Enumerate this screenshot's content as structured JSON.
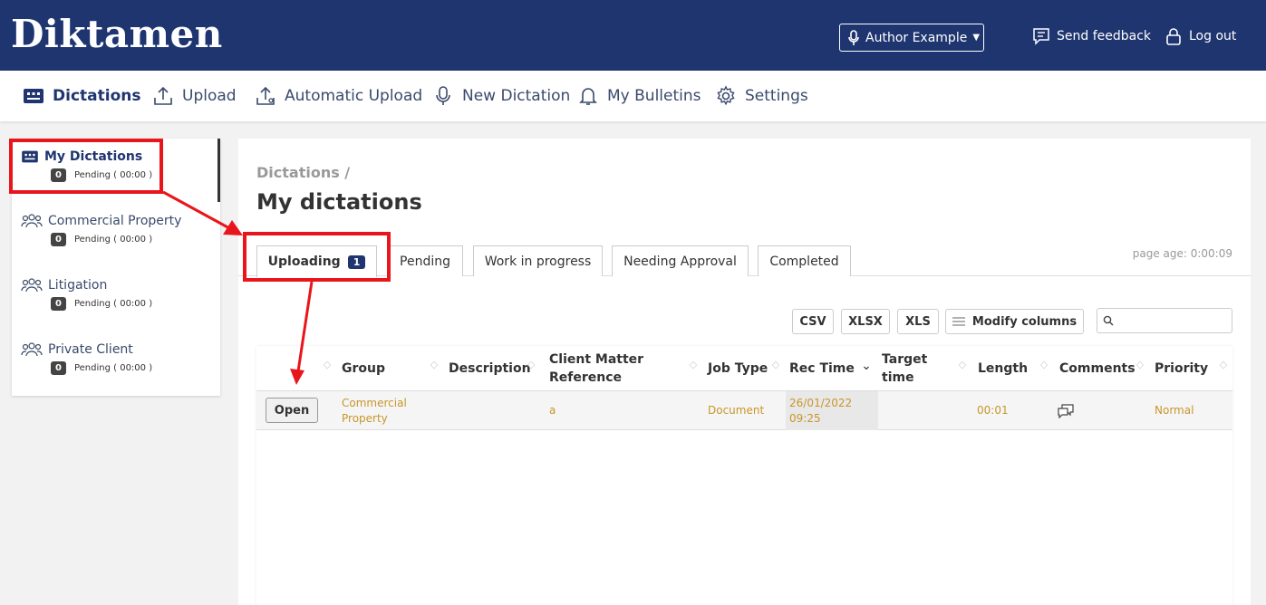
{
  "header": {
    "logo": "Diktamen",
    "author_label": "Author Example",
    "feedback_label": "Send feedback",
    "logout_label": "Log out"
  },
  "nav": {
    "items": [
      {
        "label": "Dictations",
        "icon": "dictations-icon"
      },
      {
        "label": "Upload",
        "icon": "upload-icon"
      },
      {
        "label": "Automatic Upload",
        "icon": "automatic-upload-icon"
      },
      {
        "label": "New Dictation",
        "icon": "microphone-icon"
      },
      {
        "label": "My Bulletins",
        "icon": "bell-icon"
      },
      {
        "label": "Settings",
        "icon": "gear-icon"
      }
    ]
  },
  "sidebar": {
    "items": [
      {
        "label": "My Dictations",
        "count": "0",
        "pending": "Pending ( 00:00 )"
      },
      {
        "label": "Commercial Property",
        "count": "0",
        "pending": "Pending ( 00:00 )"
      },
      {
        "label": "Litigation",
        "count": "0",
        "pending": "Pending ( 00:00 )"
      },
      {
        "label": "Private Client",
        "count": "0",
        "pending": "Pending ( 00:00 )"
      }
    ]
  },
  "main": {
    "breadcrumb": "Dictations /",
    "title": "My dictations",
    "page_age": "page age: 0:00:09",
    "tabs": [
      {
        "label": "Uploading",
        "count": "1"
      },
      {
        "label": "Pending"
      },
      {
        "label": "Work in progress"
      },
      {
        "label": "Needing Approval"
      },
      {
        "label": "Completed"
      }
    ],
    "toolbar": {
      "csv": "CSV",
      "xlsx": "XLSX",
      "xls": "XLS",
      "modify": "Modify columns",
      "search_placeholder": ""
    },
    "table": {
      "columns": [
        "Group",
        "Description",
        "Client Matter Reference",
        "Job Type",
        "Rec Time",
        "Target time",
        "Length",
        "Comments",
        "Priority"
      ],
      "rows": [
        {
          "action": "Open",
          "group": "Commercial Property",
          "description": "",
          "client_matter_reference": "a",
          "job_type": "Document",
          "rec_time": "26/01/2022 09:25",
          "target_time": "",
          "length": "00:01",
          "comments_icon": "comments-icon",
          "priority": "Normal"
        }
      ]
    }
  },
  "colors": {
    "brand": "#1f3570",
    "cell_text": "#c8962b",
    "annotation": "#e8161b"
  }
}
